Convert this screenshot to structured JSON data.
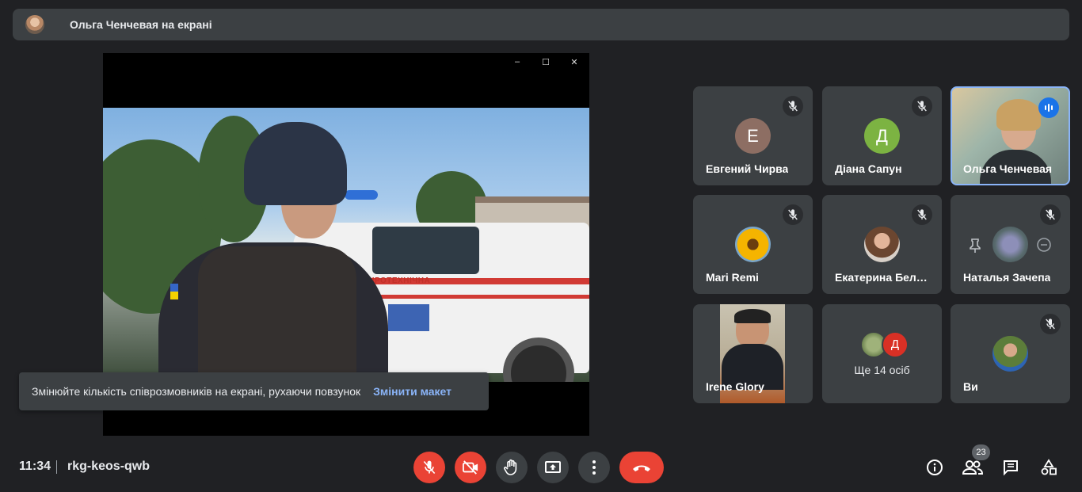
{
  "presenter_bar": {
    "title": "Ольга Ченчевая на екрані"
  },
  "presentation": {
    "window_controls": [
      "–",
      "☐",
      "✕"
    ],
    "truck_text": "ПІРОТЕХНІЧНА"
  },
  "toast": {
    "message": "Змінюйте кількість співрозмовників на екрані, рухаючи повзунок",
    "action": "Змінити макет"
  },
  "tiles": [
    {
      "name": "Евгений Чирва",
      "avatar_letter": "Е",
      "avatar_color": "#8d6e63",
      "muted": true
    },
    {
      "name": "Діана Сапун",
      "avatar_letter": "Д",
      "avatar_color": "#7cb342",
      "muted": true
    },
    {
      "name": "Ольга Ченчевая",
      "speaking": true
    },
    {
      "name": "Mari Remi",
      "avatar_icon": "sunflower",
      "muted": true
    },
    {
      "name": "Екатерина Бел…",
      "avatar_icon": "woman-portrait",
      "muted": true
    },
    {
      "name": "Наталья Зачепа",
      "avatar_icon": "lavender-photo",
      "muted": true
    },
    {
      "name": "Irene Glory",
      "video": true
    },
    {
      "name": "Ще 14 осіб",
      "stack_letter": "Д",
      "stack_color": "#d93025"
    },
    {
      "name": "Ви",
      "avatar_icon": "man-portrait",
      "muted": true
    }
  ],
  "bottom_bar": {
    "time": "11:34",
    "meeting_code": "rkg-keos-qwb",
    "participants_count": "23"
  },
  "colors": {
    "background": "#202124",
    "surface": "#3c4043",
    "danger": "#ea4335",
    "accent_link": "#8ab4f8",
    "speaking": "#1a73e8"
  }
}
